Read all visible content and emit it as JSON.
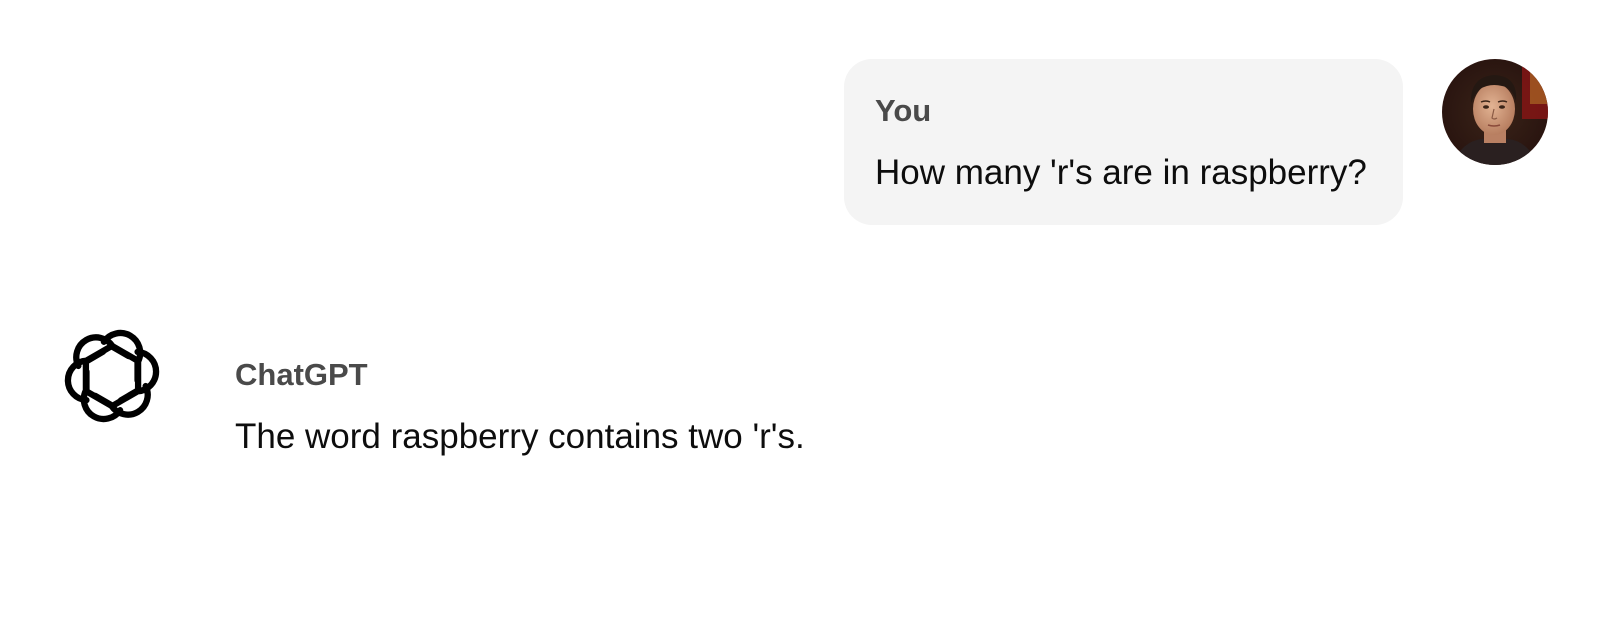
{
  "conversation": {
    "user": {
      "author": "You",
      "message": "How many 'r's are in raspberry?",
      "avatar_icon": "user-avatar-photo"
    },
    "assistant": {
      "author": "ChatGPT",
      "message": "The word raspberry contains two 'r's.",
      "avatar_icon": "openai-logo-icon"
    }
  },
  "colors": {
    "background": "#ffffff",
    "user_bubble": "#f4f4f4",
    "author_label": "#4a4a4a",
    "message_text": "#0d0d0d"
  }
}
